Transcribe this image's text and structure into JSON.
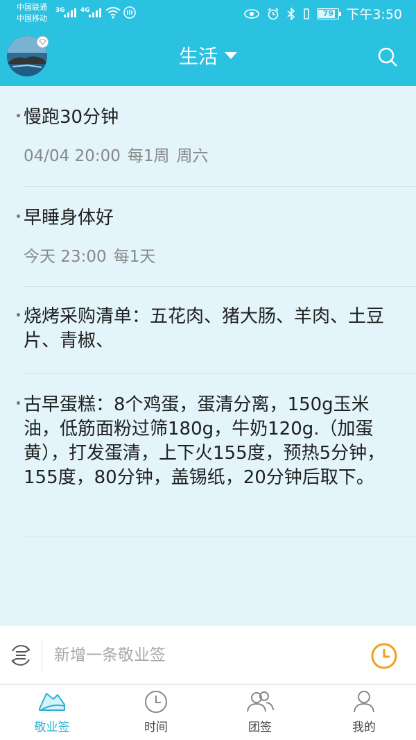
{
  "status_bar": {
    "carrier_1": "中国联通",
    "carrier_2": "中国移动",
    "net_1": "3G",
    "net_2": "4G",
    "battery": "79",
    "time": "下午3:50"
  },
  "header": {
    "title": "生活",
    "avatar_icon": "avatar-photo",
    "search_icon": "search-icon"
  },
  "notes": [
    {
      "title": "慢跑30分钟",
      "date": "04/04 20:00",
      "repeat": "每1周",
      "day": "周六"
    },
    {
      "title": "早睡身体好",
      "date": "今天 23:00",
      "repeat": "每1天"
    },
    {
      "title": "烧烤采购清单：五花肉、猪大肠、羊肉、土豆片、青椒、"
    },
    {
      "title": "古早蛋糕：8个鸡蛋，蛋清分离，150g玉米油，低筋面粉过筛180g，牛奶120g.（加蛋黄），打发蛋清，上下火155度，预热5分钟，155度，80分钟，盖锡纸，20分钟后取下。"
    }
  ],
  "input_bar": {
    "placeholder": "新增一条敬业签",
    "accent_color": "#f0a01f"
  },
  "tabs": [
    {
      "label": "敬业签",
      "icon": "note-icon",
      "active": true
    },
    {
      "label": "时间",
      "icon": "clock-icon"
    },
    {
      "label": "团签",
      "icon": "group-icon"
    },
    {
      "label": "我的",
      "icon": "person-icon"
    }
  ],
  "colors": {
    "brand": "#2bc1e0",
    "background": "#e3f4fb",
    "active_tab": "#2ab2d6"
  }
}
